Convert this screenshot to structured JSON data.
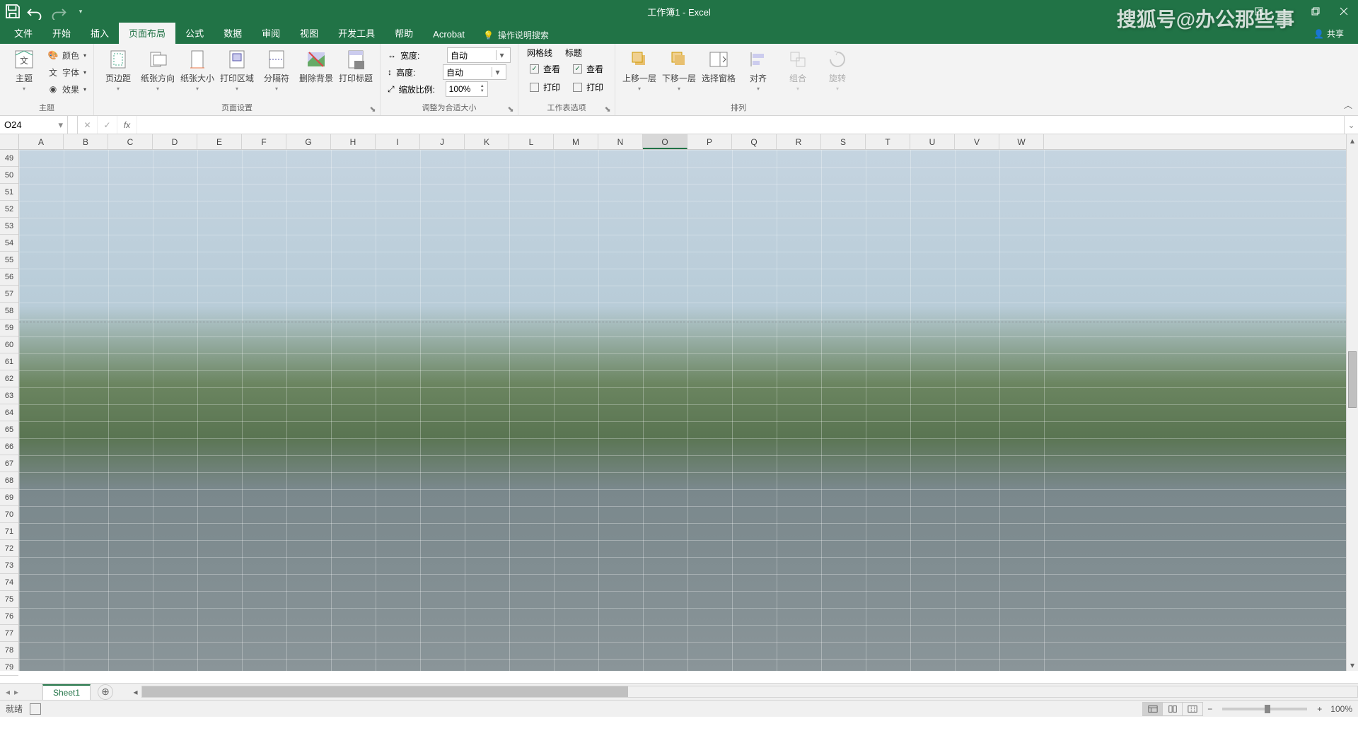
{
  "title": "工作簿1 - Excel",
  "watermark": "搜狐号@办公那些事",
  "share": "共享",
  "tabs": [
    "文件",
    "开始",
    "插入",
    "页面布局",
    "公式",
    "数据",
    "审阅",
    "视图",
    "开发工具",
    "帮助",
    "Acrobat"
  ],
  "active_tab": "页面布局",
  "tell_me": "操作说明搜索",
  "ribbon": {
    "theme": {
      "title": "主题",
      "btn": "主题",
      "colors": "颜色",
      "fonts": "字体",
      "effects": "效果"
    },
    "page_setup": {
      "title": "页面设置",
      "margins": "页边距",
      "orientation": "纸张方向",
      "size": "纸张大小",
      "print_area": "打印区域",
      "breaks": "分隔符",
      "background": "删除背景",
      "print_titles": "打印标题"
    },
    "scale": {
      "title": "调整为合适大小",
      "width": "宽度:",
      "height": "高度:",
      "auto": "自动",
      "scale_label": "缩放比例:",
      "scale_value": "100%"
    },
    "sheet_opt": {
      "title": "工作表选项",
      "gridlines": "网格线",
      "headings": "标题",
      "view": "查看",
      "print": "打印"
    },
    "arrange": {
      "title": "排列",
      "forward": "上移一层",
      "backward": "下移一层",
      "selection": "选择窗格",
      "align": "对齐",
      "group": "组合",
      "rotate": "旋转"
    }
  },
  "name_box": "O24",
  "cols": [
    "A",
    "B",
    "C",
    "D",
    "E",
    "F",
    "G",
    "H",
    "I",
    "J",
    "K",
    "L",
    "M",
    "N",
    "O",
    "P",
    "Q",
    "R",
    "S",
    "T",
    "U",
    "V",
    "W"
  ],
  "selected_col": "O",
  "rows_start": 49,
  "rows_end": 79,
  "sheets": [
    "Sheet1"
  ],
  "status": {
    "ready": "就绪",
    "zoom": "100%"
  }
}
